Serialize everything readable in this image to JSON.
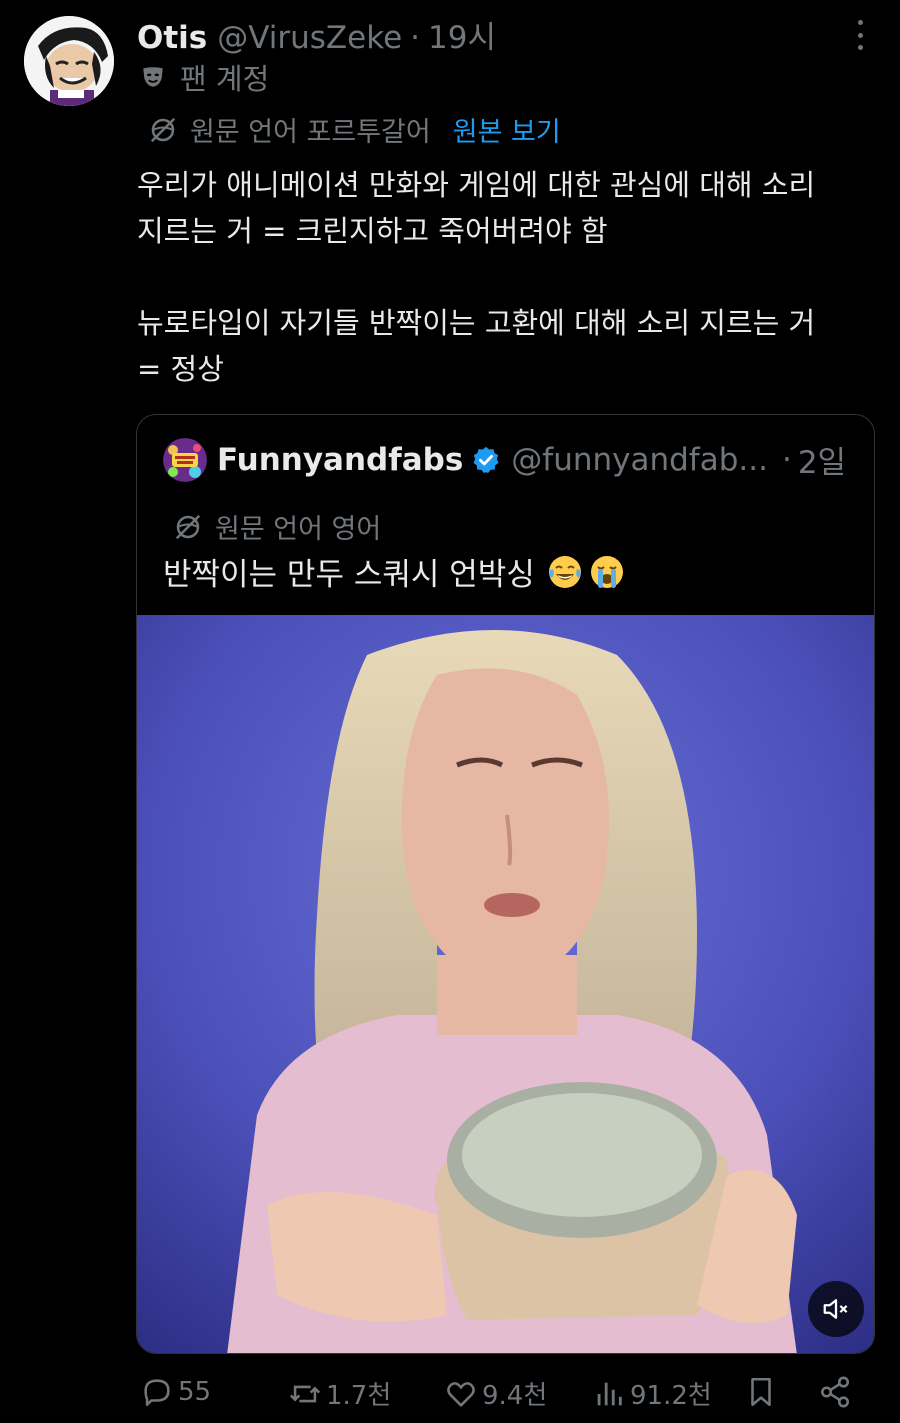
{
  "tweet": {
    "display_name": "Otis",
    "handle": "@VirusZeke",
    "separator": "·",
    "time": "19시",
    "fan_label": "팬 계정",
    "translation_notice": "원문 언어 포르투갈어",
    "show_original": "원본 보기",
    "text_lines": [
      "우리가 애니메이션 만화와 게임에 대한 관심에 대해 소리",
      "지르는 거 = 크린지하고 죽어버려야 함",
      "뉴로타입이 자기들 반짝이는 고환에 대해 소리 지르는 거",
      "= 정상"
    ]
  },
  "quote": {
    "display_name": "Funnyandfabs",
    "handle": "@funnyandfab...",
    "separator": "·",
    "time": "2일",
    "translation_notice": "원문 언어 영어",
    "text": "반짝이는 만두 스쿼시 언박싱",
    "emojis": [
      "face-with-tears-of-joy",
      "loudly-crying-face"
    ]
  },
  "actions": {
    "replies": "55",
    "retweets": "1.7천",
    "likes": "9.4천",
    "views": "91.2천"
  },
  "colors": {
    "background": "#000000",
    "text": "#e7e9ea",
    "muted": "#71767b",
    "link": "#1d9bf0",
    "border": "#2f3336"
  }
}
